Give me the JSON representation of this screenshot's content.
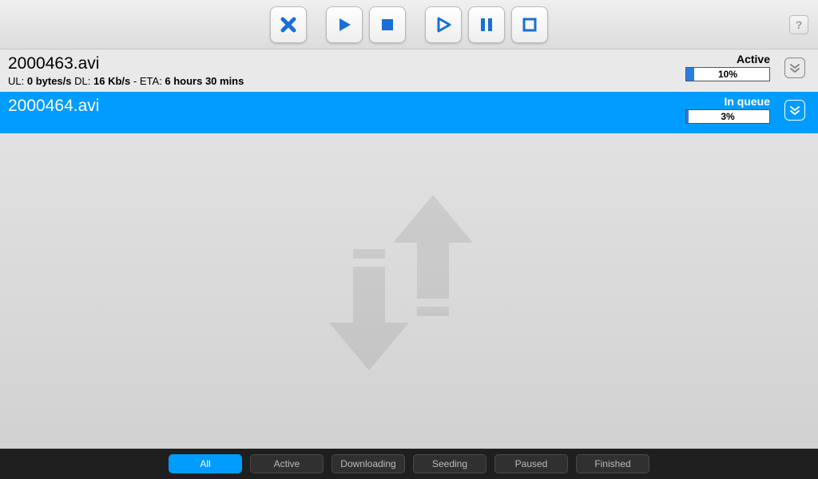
{
  "toolbar": {
    "help_label": "?"
  },
  "torrents": [
    {
      "filename": "2000463.avi",
      "status": "Active",
      "progress_pct": 10,
      "progress_text": "10%",
      "ul_label": "UL:",
      "ul_value": "0 bytes/s",
      "dl_label": "DL:",
      "dl_value": "16 Kb/s",
      "eta_label": "ETA:",
      "eta_value": "6 hours 30 mins"
    },
    {
      "filename": "2000464.avi",
      "status": "In queue",
      "progress_pct": 3,
      "progress_text": "3%"
    }
  ],
  "filters": {
    "all": "All",
    "active": "Active",
    "downloading": "Downloading",
    "seeding": "Seeding",
    "paused": "Paused",
    "finished": "Finished"
  }
}
